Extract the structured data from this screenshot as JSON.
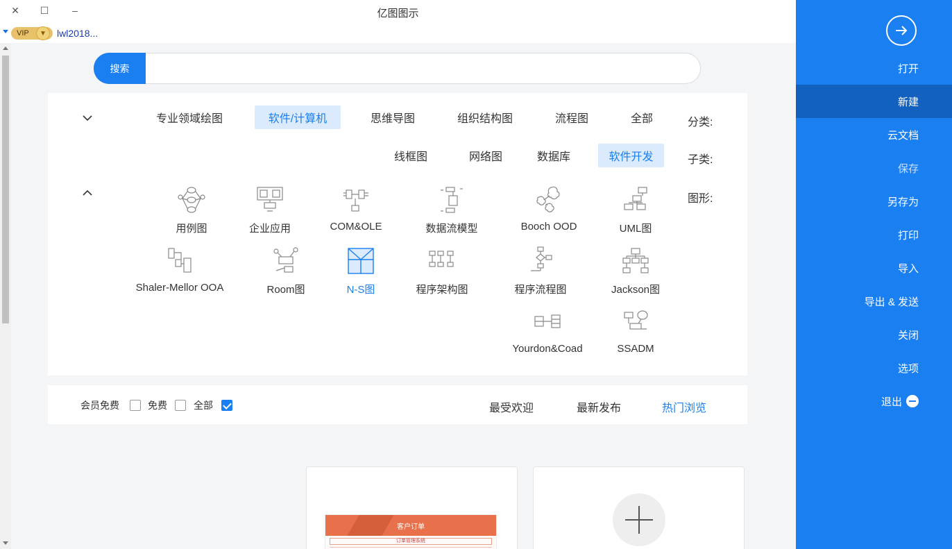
{
  "window": {
    "title": "亿图图示",
    "close": "✕",
    "maximize": "☐",
    "minimize": "–"
  },
  "user": {
    "vip": "VIP",
    "name": "lwl2018..."
  },
  "search": {
    "button": "搜索",
    "placeholder": ""
  },
  "sidebar": {
    "items": [
      {
        "label": "打开"
      },
      {
        "label": "新建"
      },
      {
        "label": "云文档"
      },
      {
        "label": "保存"
      },
      {
        "label": "另存为"
      },
      {
        "label": "打印"
      },
      {
        "label": "导入"
      },
      {
        "label": "导出 & 发送"
      },
      {
        "label": "关闭"
      },
      {
        "label": "选项"
      },
      {
        "label": "退出"
      }
    ]
  },
  "categories": {
    "label": "分类:",
    "items": [
      "全部",
      "流程图",
      "组织结构图",
      "思维导图",
      "软件/计算机",
      "专业领域绘图"
    ],
    "selected": "软件/计算机"
  },
  "subcategories": {
    "label": "子类:",
    "items": [
      "软件开发",
      "数据库",
      "网络图",
      "线框图"
    ],
    "selected": "软件开发"
  },
  "shapes": {
    "label": "图形:",
    "items": [
      "UML图",
      "Booch OOD",
      "数据流模型",
      "COM&OLE",
      "企业应用",
      "用例图",
      "Jackson图",
      "程序流程图",
      "程序架构图",
      "N-S图",
      "Room图",
      "Shaler-Mellor OOA",
      "SSADM",
      "Yourdon&Coad"
    ],
    "highlighted": "N-S图"
  },
  "filter": {
    "tabs": [
      "热门浏览",
      "最新发布",
      "最受欢迎"
    ],
    "selected": "热门浏览",
    "checks": [
      {
        "label": "全部",
        "checked": true
      },
      {
        "label": "免费",
        "checked": false
      },
      {
        "label": "会员免费",
        "checked": false
      }
    ]
  },
  "preview": {
    "title": "客户订单",
    "subtitle": "订单管理系统"
  }
}
